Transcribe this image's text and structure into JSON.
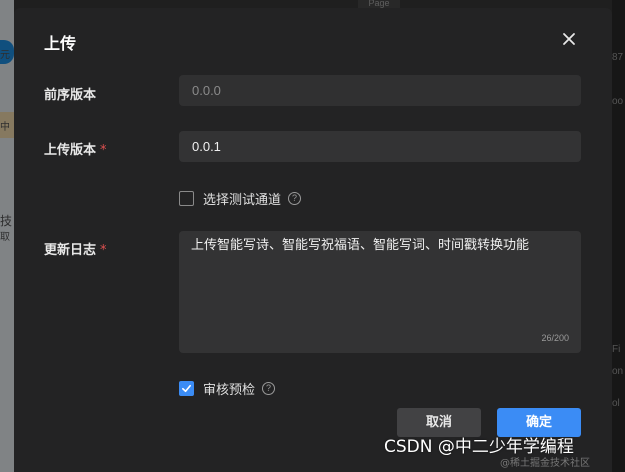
{
  "background": {
    "top_tab": "Page",
    "left_texts": [
      "元",
      "中",
      "技",
      "取"
    ],
    "right_texts": [
      "87",
      "oo",
      "Fi",
      "on",
      "ol"
    ]
  },
  "dialog": {
    "title": "上传",
    "close_icon": "close-icon",
    "fields": {
      "previous_version": {
        "label": "前序版本",
        "placeholder": "0.0.0"
      },
      "upload_version": {
        "label": "上传版本",
        "required_mark": "*",
        "value": "0.0.1"
      },
      "test_channel": {
        "label": "选择测试通道",
        "checked": false,
        "help": "?"
      },
      "changelog": {
        "label": "更新日志",
        "required_mark": "*",
        "value": "上传智能写诗、智能写祝福语、智能写词、时间戳转换功能",
        "counter": "26/200"
      },
      "review_precheck": {
        "label": "审核预检",
        "checked": true,
        "help": "?"
      }
    },
    "buttons": {
      "cancel": "取消",
      "confirm": "确定"
    }
  },
  "watermark": {
    "text": "CSDN @中二少年学编程",
    "sub": "@稀土掘金技术社区"
  },
  "colors": {
    "accent": "#3b8cf5",
    "required": "#e05151",
    "dialog_bg": "#232324"
  }
}
